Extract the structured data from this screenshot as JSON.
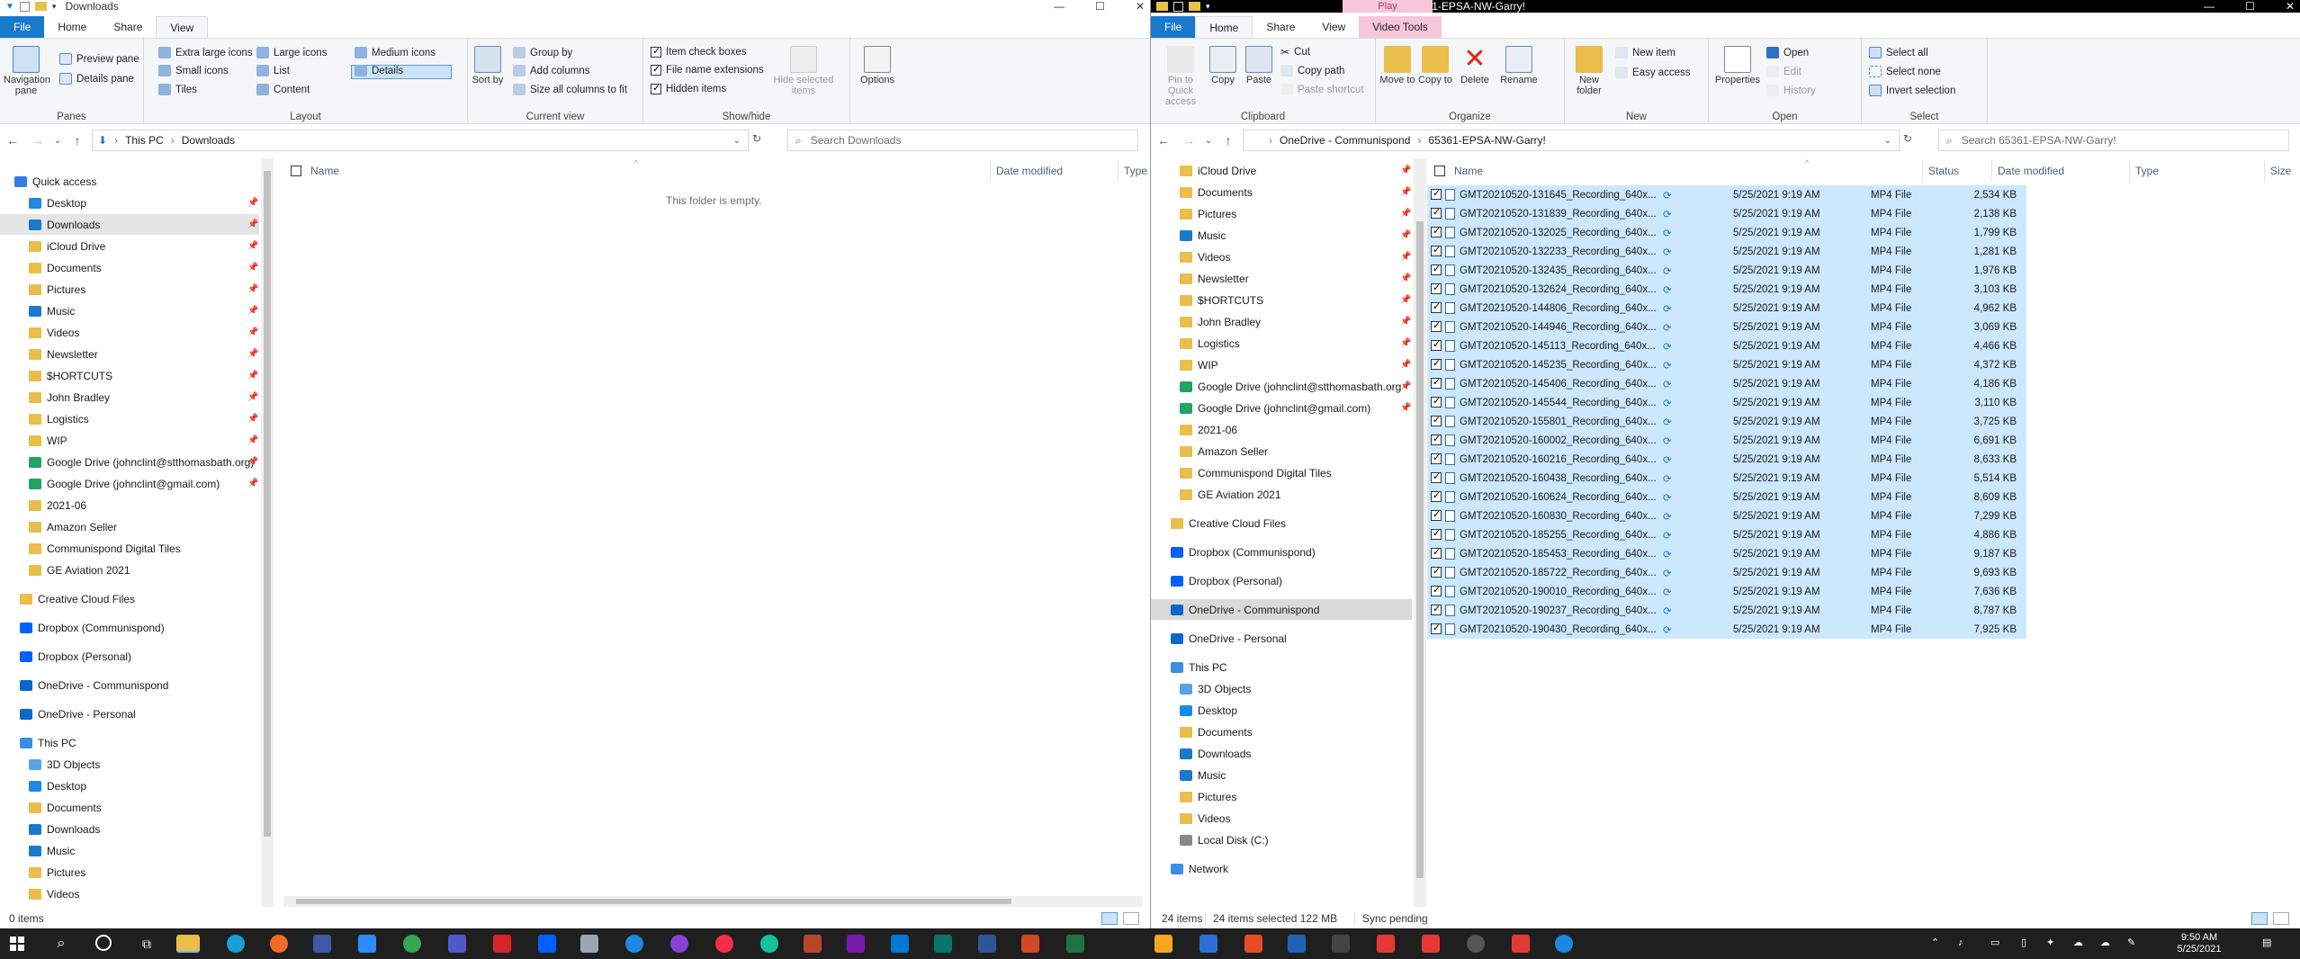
{
  "left": {
    "title": "Downloads",
    "tabs": {
      "file": "File",
      "home": "Home",
      "share": "Share",
      "view": "View"
    },
    "panes": {
      "nav": "Navigation pane",
      "preview": "Preview pane",
      "details": "Details pane",
      "label": "Panes"
    },
    "layout": {
      "xl": "Extra large icons",
      "large": "Large icons",
      "medium": "Medium icons",
      "small": "Small icons",
      "list": "List",
      "details": "Details",
      "tiles": "Tiles",
      "content": "Content",
      "label": "Layout"
    },
    "current": {
      "sort": "Sort by",
      "group": "Group by",
      "addcol": "Add columns",
      "fit": "Size all columns to fit",
      "label": "Current view"
    },
    "showhide": {
      "checkboxes": "Item check boxes",
      "extensions": "File name extensions",
      "hidden": "Hidden items",
      "hidesel": "Hide selected items",
      "label": "Show/hide"
    },
    "options": "Options",
    "crumbs": [
      "This PC",
      "Downloads"
    ],
    "search": "Search Downloads",
    "cols": {
      "name": "Name",
      "date": "Date modified",
      "type": "Type"
    },
    "empty": "This folder is empty.",
    "status": "0 items",
    "nav": [
      "Quick access",
      "Desktop",
      "Downloads",
      "iCloud Drive",
      "Documents",
      "Pictures",
      "Music",
      "Videos",
      "Newsletter",
      "$HORTCUTS",
      "John Bradley",
      "Logistics",
      "WIP",
      "Google Drive (johnclint@stthomasbath.org)",
      "Google Drive (johnclint@gmail.com)",
      "2021-06",
      "Amazon Seller",
      "Communispond Digital Tiles",
      "GE Aviation 2021",
      "Creative Cloud Files",
      "Dropbox (Communispond)",
      "Dropbox (Personal)",
      "OneDrive - Communispond",
      "OneDrive - Personal",
      "This PC",
      "3D Objects",
      "Desktop",
      "Documents",
      "Downloads",
      "Music",
      "Pictures",
      "Videos"
    ]
  },
  "right": {
    "title": "65361-EPSA-NW-Garry!",
    "play": "Play",
    "tabs": {
      "file": "File",
      "home": "Home",
      "share": "Share",
      "view": "View",
      "vt": "Video Tools"
    },
    "clipboard": {
      "pin": "Pin to Quick access",
      "copy": "Copy",
      "paste": "Paste",
      "cut": "Cut",
      "copypath": "Copy path",
      "pasteshortcut": "Paste shortcut",
      "label": "Clipboard"
    },
    "organize": {
      "move": "Move to",
      "copyto": "Copy to",
      "delete": "Delete",
      "rename": "Rename",
      "label": "Organize"
    },
    "new": {
      "folder": "New folder",
      "item": "New item",
      "easy": "Easy access",
      "label": "New"
    },
    "open": {
      "props": "Properties",
      "open": "Open",
      "edit": "Edit",
      "history": "History",
      "label": "Open"
    },
    "select": {
      "all": "Select all",
      "none": "Select none",
      "invert": "Invert selection",
      "label": "Select"
    },
    "crumbs": [
      "OneDrive - Communispond",
      "65361-EPSA-NW-Garry!"
    ],
    "search": "Search 65361-EPSA-NW-Garry!",
    "cols": {
      "name": "Name",
      "status": "Status",
      "date": "Date modified",
      "type": "Type",
      "size": "Size"
    },
    "nav": [
      "iCloud Drive",
      "Documents",
      "Pictures",
      "Music",
      "Videos",
      "Newsletter",
      "$HORTCUTS",
      "John Bradley",
      "Logistics",
      "WIP",
      "Google Drive (johnclint@stthomasbath.org)",
      "Google Drive (johnclint@gmail.com)",
      "2021-06",
      "Amazon Seller",
      "Communispond Digital Tiles",
      "GE Aviation 2021",
      "Creative Cloud Files",
      "Dropbox (Communispond)",
      "Dropbox (Personal)",
      "OneDrive - Communispond",
      "OneDrive - Personal",
      "This PC",
      "3D Objects",
      "Desktop",
      "Documents",
      "Downloads",
      "Music",
      "Pictures",
      "Videos",
      "Local Disk (C:)",
      "Network"
    ],
    "files": [
      {
        "name": "GMT20210520-131645_Recording_640x...",
        "date": "5/25/2021 9:19 AM",
        "type": "MP4 File",
        "size": "2,534 KB"
      },
      {
        "name": "GMT20210520-131839_Recording_640x...",
        "date": "5/25/2021 9:19 AM",
        "type": "MP4 File",
        "size": "2,138 KB"
      },
      {
        "name": "GMT20210520-132025_Recording_640x...",
        "date": "5/25/2021 9:19 AM",
        "type": "MP4 File",
        "size": "1,799 KB"
      },
      {
        "name": "GMT20210520-132233_Recording_640x...",
        "date": "5/25/2021 9:19 AM",
        "type": "MP4 File",
        "size": "1,281 KB"
      },
      {
        "name": "GMT20210520-132435_Recording_640x...",
        "date": "5/25/2021 9:19 AM",
        "type": "MP4 File",
        "size": "1,976 KB"
      },
      {
        "name": "GMT20210520-132624_Recording_640x...",
        "date": "5/25/2021 9:19 AM",
        "type": "MP4 File",
        "size": "3,103 KB"
      },
      {
        "name": "GMT20210520-144806_Recording_640x...",
        "date": "5/25/2021 9:19 AM",
        "type": "MP4 File",
        "size": "4,962 KB"
      },
      {
        "name": "GMT20210520-144946_Recording_640x...",
        "date": "5/25/2021 9:19 AM",
        "type": "MP4 File",
        "size": "3,069 KB"
      },
      {
        "name": "GMT20210520-145113_Recording_640x...",
        "date": "5/25/2021 9:19 AM",
        "type": "MP4 File",
        "size": "4,466 KB"
      },
      {
        "name": "GMT20210520-145235_Recording_640x...",
        "date": "5/25/2021 9:19 AM",
        "type": "MP4 File",
        "size": "4,372 KB"
      },
      {
        "name": "GMT20210520-145406_Recording_640x...",
        "date": "5/25/2021 9:19 AM",
        "type": "MP4 File",
        "size": "4,186 KB"
      },
      {
        "name": "GMT20210520-145544_Recording_640x...",
        "date": "5/25/2021 9:19 AM",
        "type": "MP4 File",
        "size": "3,110 KB"
      },
      {
        "name": "GMT20210520-155801_Recording_640x...",
        "date": "5/25/2021 9:19 AM",
        "type": "MP4 File",
        "size": "3,725 KB"
      },
      {
        "name": "GMT20210520-160002_Recording_640x...",
        "date": "5/25/2021 9:19 AM",
        "type": "MP4 File",
        "size": "6,691 KB"
      },
      {
        "name": "GMT20210520-160216_Recording_640x...",
        "date": "5/25/2021 9:19 AM",
        "type": "MP4 File",
        "size": "8,633 KB"
      },
      {
        "name": "GMT20210520-160438_Recording_640x...",
        "date": "5/25/2021 9:19 AM",
        "type": "MP4 File",
        "size": "5,514 KB"
      },
      {
        "name": "GMT20210520-160624_Recording_640x...",
        "date": "5/25/2021 9:19 AM",
        "type": "MP4 File",
        "size": "8,609 KB"
      },
      {
        "name": "GMT20210520-160830_Recording_640x...",
        "date": "5/25/2021 9:19 AM",
        "type": "MP4 File",
        "size": "7,299 KB"
      },
      {
        "name": "GMT20210520-185255_Recording_640x...",
        "date": "5/25/2021 9:19 AM",
        "type": "MP4 File",
        "size": "4,886 KB"
      },
      {
        "name": "GMT20210520-185453_Recording_640x...",
        "date": "5/25/2021 9:19 AM",
        "type": "MP4 File",
        "size": "9,187 KB"
      },
      {
        "name": "GMT20210520-185722_Recording_640x...",
        "date": "5/25/2021 9:19 AM",
        "type": "MP4 File",
        "size": "9,693 KB"
      },
      {
        "name": "GMT20210520-190010_Recording_640x...",
        "date": "5/25/2021 9:19 AM",
        "type": "MP4 File",
        "size": "7,636 KB"
      },
      {
        "name": "GMT20210520-190237_Recording_640x...",
        "date": "5/25/2021 9:19 AM",
        "type": "MP4 File",
        "size": "8,787 KB"
      },
      {
        "name": "GMT20210520-190430_Recording_640x...",
        "date": "5/25/2021 9:19 AM",
        "type": "MP4 File",
        "size": "7,925 KB"
      }
    ],
    "status": {
      "items": "24 items",
      "selected": "24 items selected  122 MB",
      "sync": "Sync pending"
    }
  },
  "taskbar": {
    "time": "9:50 AM",
    "date": "5/25/2021"
  }
}
